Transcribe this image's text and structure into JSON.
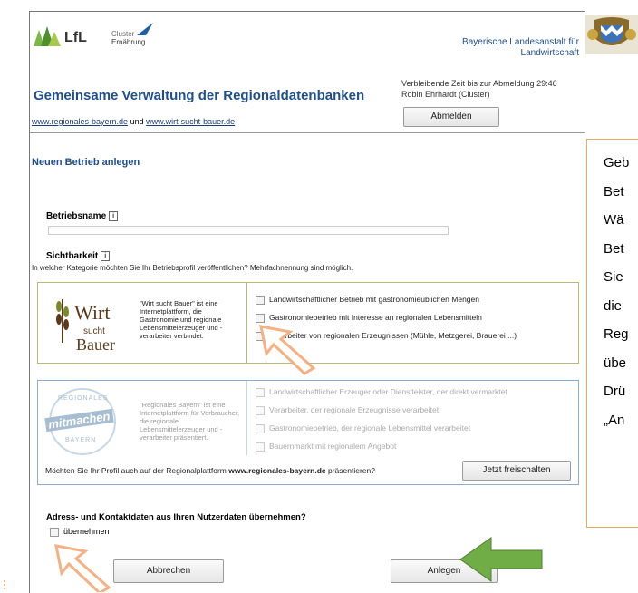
{
  "header": {
    "lfl_logo_text": "LfL",
    "cluster_logo_line1": "Cluster",
    "cluster_logo_line2": "Ernährung",
    "institution_line1": "Bayerische Landesanstalt für",
    "institution_line2": "Landwirtschaft",
    "session_timer": "Verbleibende Zeit bis zur Abmeldung 29:46",
    "user_name": "Robin Ehrhardt  (Cluster)",
    "logout_label": "Abmelden",
    "page_title": "Gemeinsame Verwaltung der Regionaldatenbanken",
    "link1": "www.regionales-bayern.de",
    "link_connector": "und",
    "link2": "www.wirt-sucht-bauer.de"
  },
  "form": {
    "section_title": "Neuen Betrieb anlegen",
    "name_label": "Betriebsname",
    "name_value": "",
    "visibility_label": "Sichtbarkeit",
    "visibility_question": "In welcher Kategorie möchten Sie Ihr Betriebsprofil veröffentlichen? Mehrfachnennung sind möglich.",
    "wsb_box": {
      "logo_line1": "Wirt",
      "logo_line2": "sucht",
      "logo_line3": "Bauer",
      "description": "\"Wirt sucht Bauer\" ist eine Internetplattform, die Gastronomie und regionale Lebensmittelerzeuger und -verarbeiter verbindet.",
      "options": [
        "Landwirtschaftlicher Betrieb mit gastronomieüblichen Mengen",
        "Gastronomiebetrieb mit Interesse an regionalen Lebensmitteln",
        "Verarbeiter von regionalen Erzeugnissen (Mühle, Metzgerei, Brauerei ...)"
      ]
    },
    "rb_box": {
      "logo_top": "REGIONALES",
      "logo_mid": "mitmachen",
      "logo_bottom": "BAYERN",
      "description": "\"Regionales Bayern\" ist eine Internetplattform für Verbraucher, die regionale Lebensmittelerzeuger und -verarbeiter präsentiert.",
      "options": [
        "Landwirtschaftlicher Erzeuger oder Dienstleister, der direkt vermarktet",
        "Verarbeiter, der regionale Erzeugnisse verarbeitet",
        "Gastronomiebetrieb, der regionale Lebensmittel verarbeitet",
        "Bauernmarkt mit regionalem Angebot"
      ],
      "unlock_question_prefix": "Möchten Sie Ihr Profil auch auf der Regionalplattform",
      "unlock_question_site": "www.regionales-bayern.de",
      "unlock_question_suffix": "präsentieren?",
      "unlock_button": "Jetzt freischalten"
    },
    "address_question": "Adress- und Kontaktdaten aus Ihren Nutzerdaten übernehmen?",
    "adopt_label": "übernehmen",
    "cancel_label": "Abbrechen",
    "create_label": "Anlegen"
  },
  "callout": {
    "lines": [
      "Geb",
      "Bet",
      "Wä",
      "Bet",
      "Sie",
      "die",
      "Reg",
      "übe",
      "Drü",
      "„An"
    ]
  },
  "colors": {
    "orange_arrow": "#f4b183",
    "green_arrow": "#70ad47",
    "callout_border": "#f0a860",
    "title_blue": "#1f4e8c"
  }
}
